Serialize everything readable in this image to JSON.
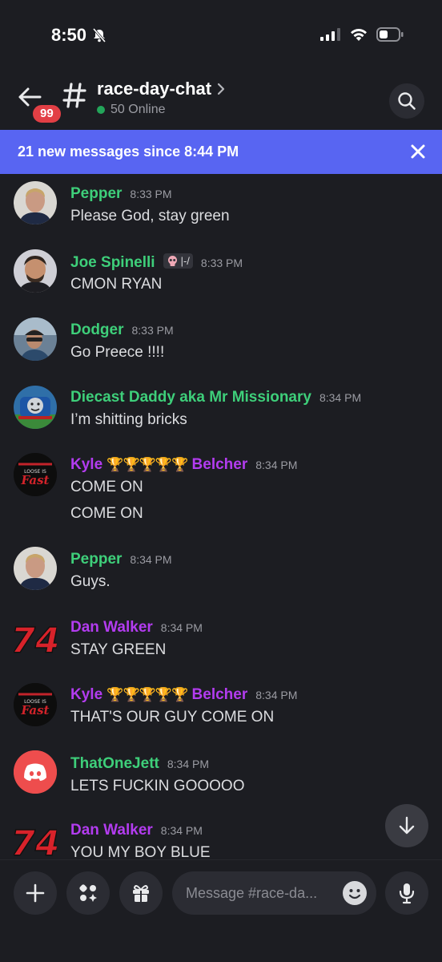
{
  "status_bar": {
    "time": "8:50"
  },
  "header": {
    "badge_count": "99",
    "channel_name": "race-day-chat",
    "online_text": "50 Online"
  },
  "banner": {
    "text": "21 new messages since 8:44 PM"
  },
  "messages": [
    {
      "author": "Pepper",
      "time": "8:33 PM",
      "text": [
        "Please God, stay green"
      ]
    },
    {
      "author": "Joe Spinelli",
      "tag": "|-/",
      "time": "8:33 PM",
      "text": [
        "CMON RYAN"
      ]
    },
    {
      "author": "Dodger",
      "time": "8:33 PM",
      "text": [
        "Go Preece !!!!"
      ]
    },
    {
      "author": "Diecast Daddy aka Mr Missionary",
      "time": "8:34 PM",
      "text": [
        "I’m shitting bricks"
      ]
    },
    {
      "author_first": "Kyle",
      "author_last": "Belcher",
      "trophies": "🏆🏆🏆🏆🏆",
      "time": "8:34 PM",
      "text": [
        "COME ON",
        "COME ON"
      ]
    },
    {
      "author": "Pepper",
      "time": "8:34 PM",
      "text": [
        "Guys."
      ]
    },
    {
      "author": "Dan Walker",
      "time": "8:34 PM",
      "text": [
        "STAY GREEN"
      ]
    },
    {
      "author_first": "Kyle",
      "author_last": "Belcher",
      "trophies": "🏆🏆🏆🏆🏆",
      "time": "8:34 PM",
      "text": [
        "THAT'S OUR GUY COME ON"
      ]
    },
    {
      "author": "ThatOneJett",
      "time": "8:34 PM",
      "text": [
        "LETS FUCKIN GOOOOO"
      ]
    },
    {
      "author": "Dan Walker",
      "time": "8:34 PM",
      "text": [
        "YOU MY BOY BLUE"
      ]
    }
  ],
  "avatar_labels": {
    "kyle_line1": "LOOSE IS",
    "kyle_line2": "Fast",
    "dan_number": "74"
  },
  "composer": {
    "placeholder": "Message #race-da..."
  },
  "colors": {
    "accent": "#5865f2",
    "online": "#23a55a",
    "green_role": "#3ecf7a",
    "purple_role": "#b33cf0",
    "badge": "#e23f45"
  }
}
